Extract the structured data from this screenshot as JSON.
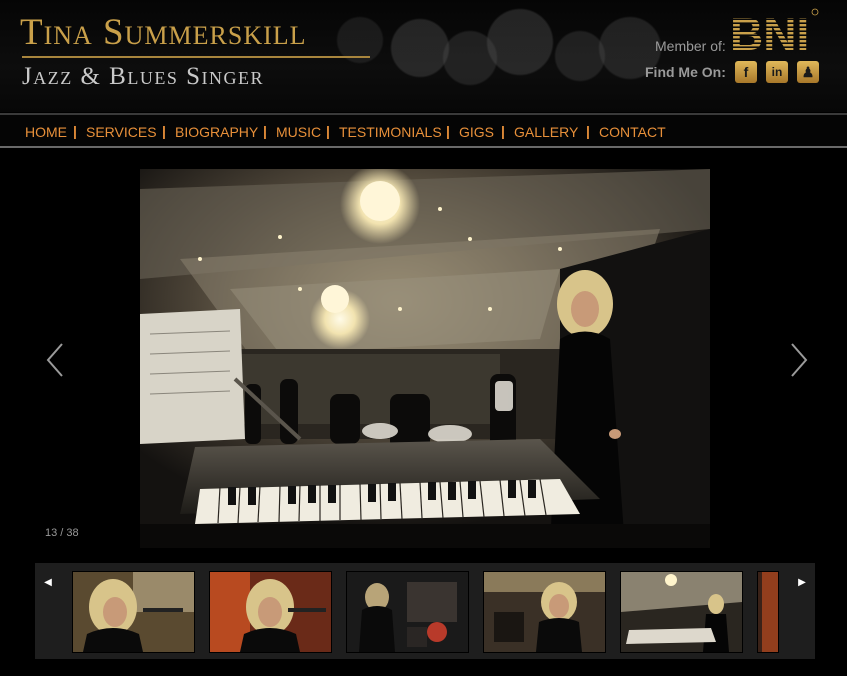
{
  "header": {
    "name": "Tina Summerskill",
    "tagline": "Jazz & Blues Singer",
    "member_label": "Member of:",
    "bni_text": "BNI",
    "find_label": "Find Me On:",
    "social": [
      {
        "name": "facebook",
        "glyph": "f"
      },
      {
        "name": "linkedin",
        "glyph": "in"
      },
      {
        "name": "myspace",
        "glyph": "♟"
      }
    ]
  },
  "nav": {
    "items": [
      "HOME",
      "SERVICES",
      "BIOGRAPHY",
      "MUSIC",
      "TESTIMONIALS",
      "GIGS",
      "GALLERY",
      "CONTACT"
    ],
    "separator": "|"
  },
  "gallery": {
    "counter": "13 / 38",
    "prev_icon": "chevron-left-icon",
    "next_icon": "chevron-right-icon"
  },
  "thumbstrip": {
    "prev_glyph": "◀",
    "next_glyph": "▶",
    "thumbs": 6
  },
  "colors": {
    "accent": "#e8903a",
    "gold": "#c9a04a",
    "background": "#000000"
  }
}
